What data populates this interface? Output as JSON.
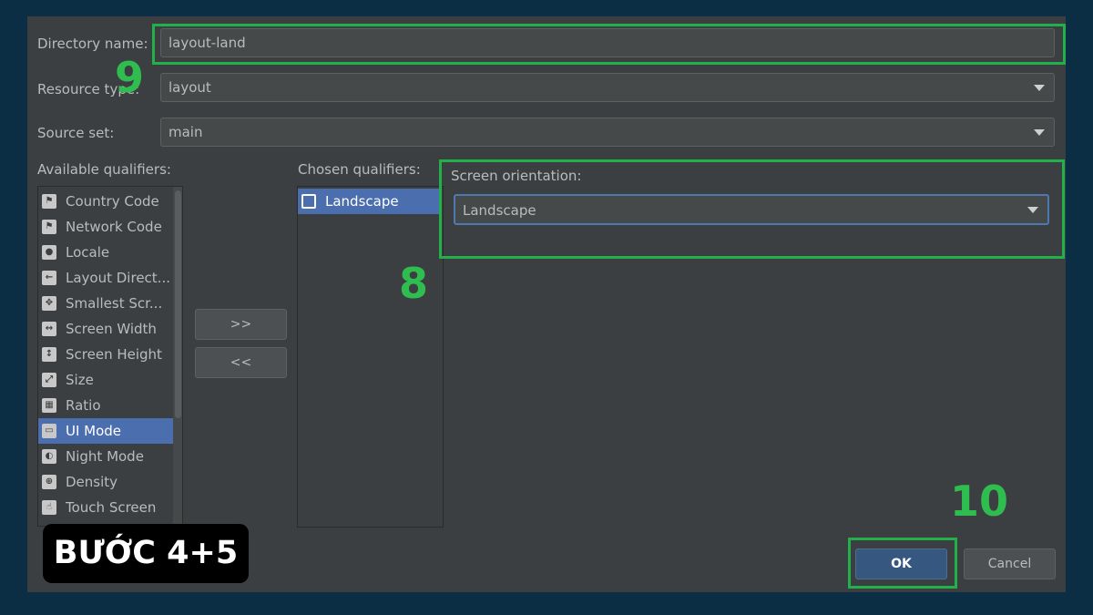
{
  "form": {
    "directory_label": "Directory name:",
    "directory_value": "layout-land",
    "resource_type_label": "Resource type:",
    "resource_type_value": "layout",
    "source_set_label": "Source set:",
    "source_set_value": "main"
  },
  "available": {
    "label": "Available qualifiers:",
    "items": [
      {
        "label": "Country Code",
        "icon": "country-code-icon"
      },
      {
        "label": "Network Code",
        "icon": "network-code-icon"
      },
      {
        "label": "Locale",
        "icon": "globe-icon"
      },
      {
        "label": "Layout Direct...",
        "icon": "layout-direction-icon"
      },
      {
        "label": "Smallest Scr...",
        "icon": "smallest-screen-icon"
      },
      {
        "label": "Screen Width",
        "icon": "screen-width-icon"
      },
      {
        "label": "Screen Height",
        "icon": "screen-height-icon"
      },
      {
        "label": "Size",
        "icon": "size-icon"
      },
      {
        "label": "Ratio",
        "icon": "ratio-icon"
      },
      {
        "label": "UI Mode",
        "icon": "ui-mode-icon",
        "selected": true
      },
      {
        "label": "Night Mode",
        "icon": "night-mode-icon"
      },
      {
        "label": "Density",
        "icon": "density-icon"
      },
      {
        "label": "Touch Screen",
        "icon": "touch-screen-icon"
      }
    ]
  },
  "transfer": {
    "add_label": ">>",
    "remove_label": "<<"
  },
  "chosen": {
    "label": "Chosen qualifiers:",
    "items": [
      {
        "label": "Landscape",
        "icon": "landscape-icon",
        "selected": true
      }
    ]
  },
  "orientation": {
    "label": "Screen orientation:",
    "value": "Landscape"
  },
  "buttons": {
    "ok_label": "OK",
    "cancel_label": "Cancel"
  },
  "annotations": {
    "step_8": "8",
    "step_9": "9",
    "step_10": "10",
    "badge": "BƯỚC 4+5"
  },
  "colors": {
    "background": "#0b2e45",
    "dialog": "#3c3f41",
    "highlight": "#22b04b",
    "selection": "#4b6eaf"
  }
}
